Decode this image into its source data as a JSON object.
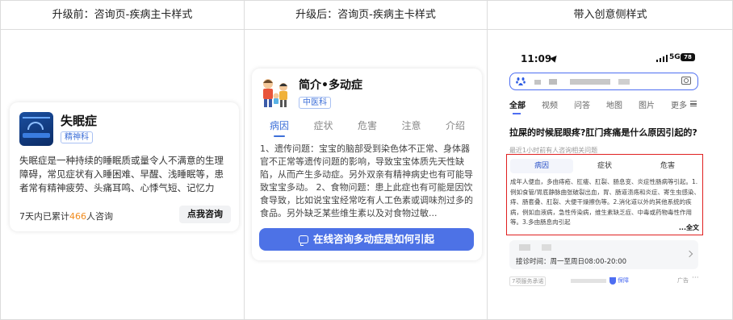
{
  "headers": [
    "升级前：咨询页-疾病主卡样式",
    "升级后：咨询页-疾病主卡样式",
    "带入创意侧样式"
  ],
  "before_card": {
    "title": "失眠症",
    "tag": "精神科",
    "description": "失眠症是一种持续的睡眠质或量令人不满意的生理障碍，常见症状有入睡困难、早醒、浅睡眠等，患者常有精神疲劳、头痛耳鸣、心悸气短、记忆力差、工...",
    "count_prefix": "7天内已累计",
    "count_value": "466",
    "count_suffix": "人咨询",
    "button": "点我咨询"
  },
  "after_card": {
    "title": "简介•多动症",
    "tag": "中医科",
    "tabs": [
      "病因",
      "症状",
      "危害",
      "注意",
      "介绍"
    ],
    "active_tab": 0,
    "body": "1、遗传问题：宝宝的脑部受到染色体不正常、身体器官不正常等遗传问题的影响，导致宝宝体质先天性缺陷，从而产生多动症。另外双亲有精神病史也有可能导致宝宝多动。 2、食物问题：患上此症也有可能是因饮食导致，比如说宝宝经常吃有人工色素或调味剂过多的食品。另外缺乏某些维生素以及对食物过敏...",
    "cta": "在线咨询多动症是如何引起"
  },
  "phone": {
    "time": "11:09",
    "network": "5G",
    "battery": "78",
    "nav": [
      "全部",
      "视频",
      "问答",
      "地图",
      "图片",
      "更多"
    ],
    "question": "拉屎的时候屁眼疼?肛门疼痛是什么原因引起的?",
    "meta": "最近1小时前有人咨询相关问题",
    "box_tabs": [
      "病因",
      "症状",
      "危害"
    ],
    "box_text": "成年人便血，多由痔疮、肛瘘、肛裂、肠息变、炎症性肠病等引起。1.例如食管/胃底静脉曲张破裂出血，胃、肠道溃疡和炎症、寄生虫感染、痔、肠套叠、肛裂、大便干燥擦伤等。2.消化道以外的其他系统的疾病，例如血液病，急性传染病，维生素缺乏症、中毒或药物毒性作用等。3.多由肠息肉引起",
    "box_more": "...全文",
    "sub_text": "接诊时间：周一至周日08:00-20:00",
    "footer_source": "7项服务承诺",
    "footer_safe": "保障",
    "footer_ad": "广告"
  },
  "colors": {
    "accent": "#3d6fd8",
    "cta": "#4d72e6",
    "highlight_border": "#e02020",
    "count_orange": "#f08a1c"
  }
}
